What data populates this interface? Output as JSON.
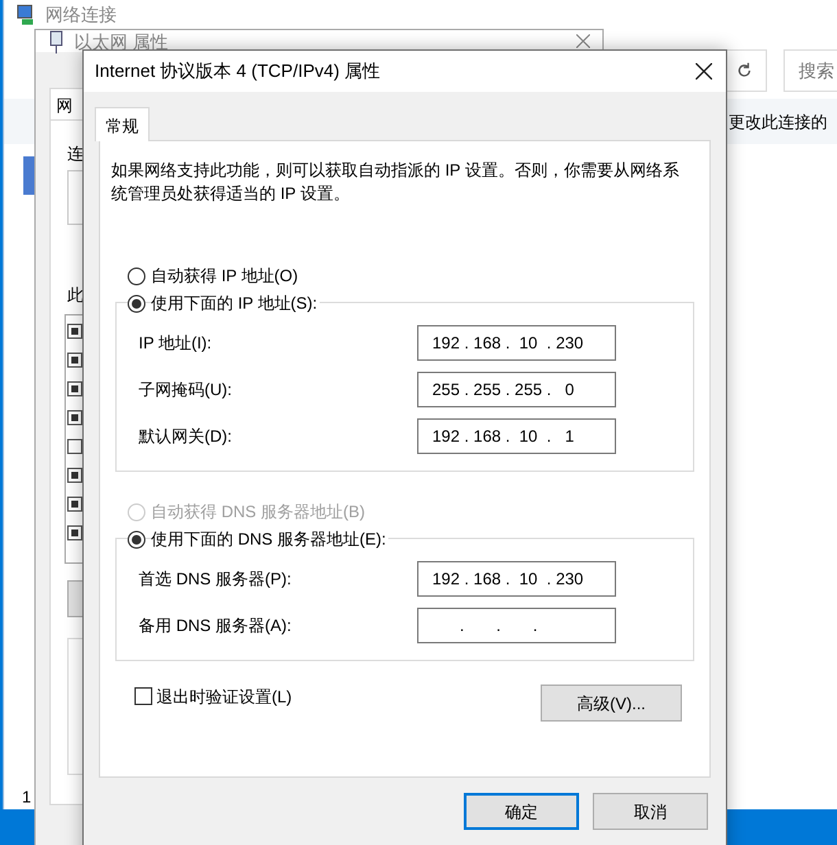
{
  "explorer": {
    "title": "网络连接",
    "search_placeholder": "搜索",
    "command": "更改此连接的",
    "status": "1"
  },
  "ethernet": {
    "title": "以太网 属性",
    "tab": "网",
    "labels": [
      "连",
      "此"
    ],
    "items": [
      {
        "checked": true
      },
      {
        "checked": true
      },
      {
        "checked": true
      },
      {
        "checked": true
      },
      {
        "checked": false
      },
      {
        "checked": true
      },
      {
        "checked": true
      },
      {
        "checked": true
      }
    ]
  },
  "dialog": {
    "title": "Internet 协议版本 4 (TCP/IPv4) 属性",
    "tabs": [
      {
        "label": "常规",
        "selected": true
      }
    ],
    "description": "如果网络支持此功能，则可以获取自动指派的 IP 设置。否则，你需要从网络系统管理员处获得适当的 IP 设置。",
    "ip_options": [
      {
        "label": "自动获得 IP 地址(O)",
        "selected": false,
        "disabled": false
      },
      {
        "label": "使用下面的 IP 地址(S):",
        "selected": true,
        "disabled": false
      }
    ],
    "ip_fields": [
      {
        "label": "IP 地址(I):",
        "value": "192 . 168 .  10  . 230"
      },
      {
        "label": "子网掩码(U):",
        "value": "255 . 255 . 255 .   0"
      },
      {
        "label": "默认网关(D):",
        "value": "192 . 168 .  10  .   1"
      }
    ],
    "dns_options": [
      {
        "label": "自动获得 DNS 服务器地址(B)",
        "selected": false,
        "disabled": true
      },
      {
        "label": "使用下面的 DNS 服务器地址(E):",
        "selected": true,
        "disabled": false
      }
    ],
    "dns_fields": [
      {
        "label": "首选 DNS 服务器(P):",
        "value": "192 . 168 .  10  . 230"
      },
      {
        "label": "备用 DNS 服务器(A):",
        "value": "      .       .       ."
      }
    ],
    "validate": {
      "label": "退出时验证设置(L)",
      "checked": false
    },
    "advanced_button": "高级(V)...",
    "buttons": [
      {
        "label": "确定",
        "default": true
      },
      {
        "label": "取消",
        "default": false
      }
    ]
  }
}
